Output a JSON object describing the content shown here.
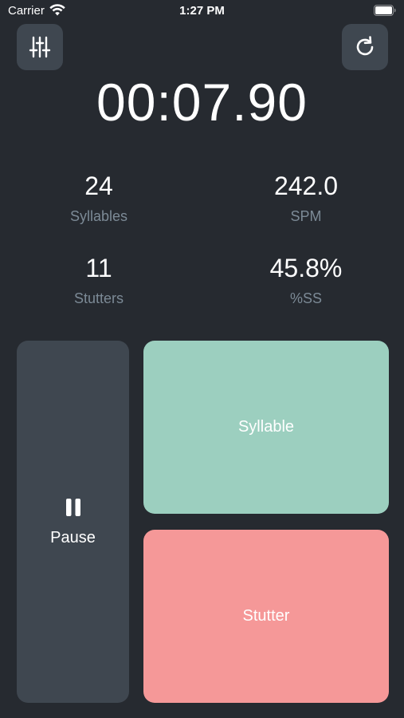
{
  "status_bar": {
    "carrier": "Carrier",
    "time": "1:27 PM"
  },
  "toolbar": {
    "settings_icon": "sliders-icon",
    "reset_icon": "refresh-icon"
  },
  "timer": {
    "display": "00:07.90"
  },
  "stats": {
    "syllables": {
      "value": "24",
      "label": "Syllables"
    },
    "spm": {
      "value": "242.0",
      "label": "SPM"
    },
    "stutters": {
      "value": "11",
      "label": "Stutters"
    },
    "percent_ss": {
      "value": "45.8%",
      "label": "%SS"
    }
  },
  "controls": {
    "pause_label": "Pause",
    "syllable_label": "Syllable",
    "stutter_label": "Stutter"
  },
  "colors": {
    "background": "#262a30",
    "panel": "#3f4750",
    "syllable": "#9ccfbf",
    "stutter": "#f59898",
    "muted_text": "#7c8a96"
  }
}
